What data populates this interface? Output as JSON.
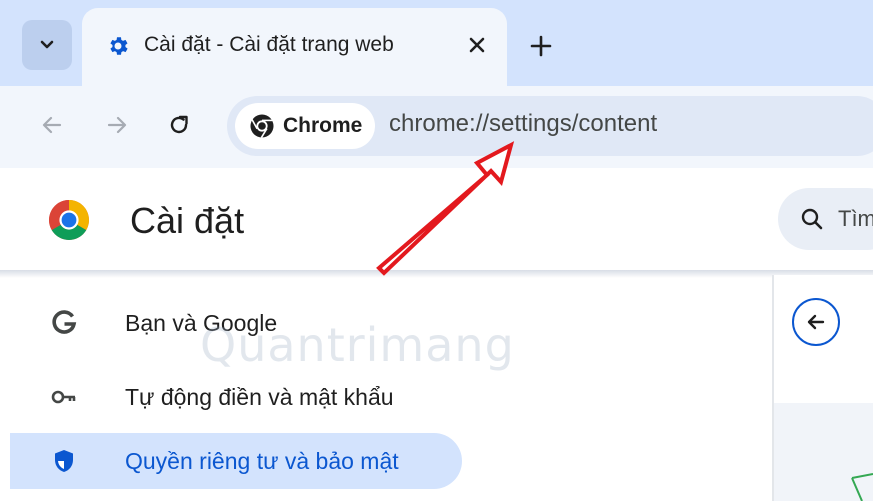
{
  "browser": {
    "tab": {
      "title": "Cài đặt - Cài đặt trang web",
      "favicon": "gear-icon"
    },
    "tab_search_icon": "chevron-down-icon",
    "new_tab_icon": "plus-icon",
    "toolbar": {
      "back_icon": "arrow-left-icon",
      "forward_icon": "arrow-right-icon",
      "reload_icon": "reload-icon"
    },
    "omnibox": {
      "chip_label": "Chrome",
      "url": "chrome://settings/content"
    }
  },
  "settings": {
    "title": "Cài đặt",
    "search_partial": "Tìm",
    "menu": [
      {
        "label": "Bạn và Google",
        "icon": "google-g-icon",
        "selected": false
      },
      {
        "label": "Tự động điền và mật khẩu",
        "icon": "key-icon",
        "selected": false
      },
      {
        "label": "Quyền riêng tư và bảo mật",
        "icon": "shield-icon",
        "selected": true
      }
    ]
  },
  "colors": {
    "accent": "#0b57d0",
    "tabstrip": "#d3e3fd",
    "toolbar": "#f2f6fc",
    "annotation_arrow": "#e3191e"
  },
  "watermark": "Quantrimang"
}
